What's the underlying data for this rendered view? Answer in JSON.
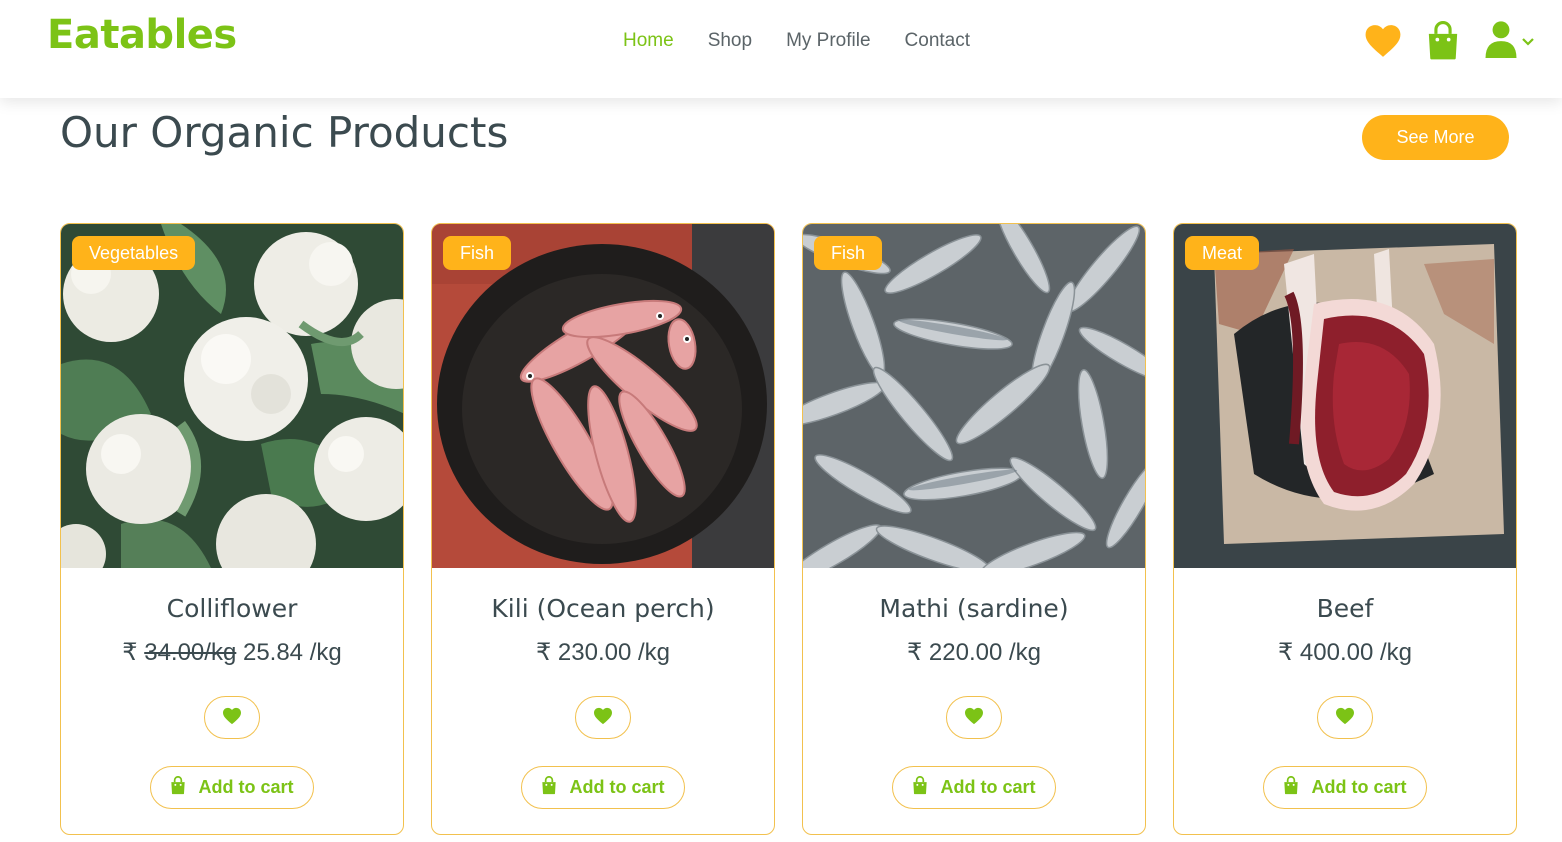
{
  "brand": {
    "name": "Eatables",
    "color": "#7cc316",
    "accent": "#ffb31a"
  },
  "nav": {
    "items": [
      "Home",
      "Shop",
      "My Profile",
      "Contact"
    ],
    "active": "Home"
  },
  "header_icons": [
    "heart-icon",
    "shopping-bag-icon",
    "user-icon",
    "chevron-down-icon"
  ],
  "section": {
    "title": "Our Organic Products",
    "see_more_label": "See More"
  },
  "products": [
    {
      "category": "Vegetables",
      "name": "Colliflower",
      "currency": "₹",
      "old_price": "34.00/kg",
      "price": "25.84 /kg",
      "wishlist_icon": "heart-icon",
      "cart_label": "Add to cart",
      "cart_icon": "shopping-bag-icon"
    },
    {
      "category": "Fish",
      "name": "Kili (Ocean perch)",
      "currency": "₹",
      "old_price": "",
      "price": "230.00 /kg",
      "wishlist_icon": "heart-icon",
      "cart_label": "Add to cart",
      "cart_icon": "shopping-bag-icon"
    },
    {
      "category": "Fish",
      "name": "Mathi (sardine)",
      "currency": "₹",
      "old_price": "",
      "price": "220.00 /kg",
      "wishlist_icon": "heart-icon",
      "cart_label": "Add to cart",
      "cart_icon": "shopping-bag-icon"
    },
    {
      "category": "Meat",
      "name": "Beef",
      "currency": "₹",
      "old_price": "",
      "price": "400.00 /kg",
      "wishlist_icon": "heart-icon",
      "cart_label": "Add to cart",
      "cart_icon": "shopping-bag-icon"
    }
  ]
}
